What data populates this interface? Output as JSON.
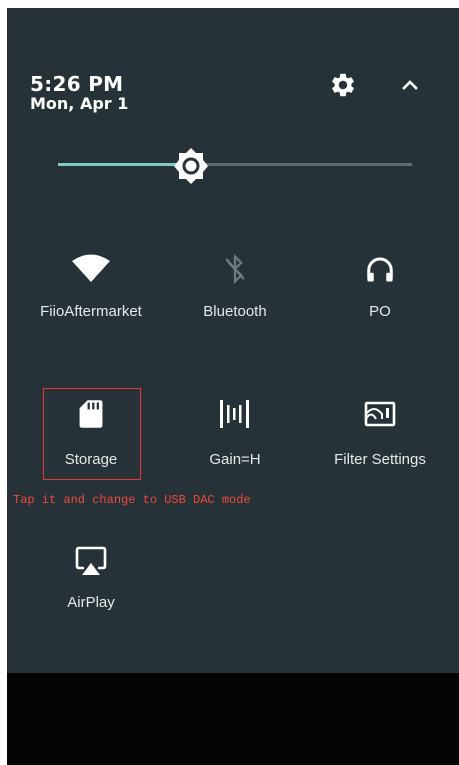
{
  "status": {
    "time": "5:26 PM",
    "date": "Mon, Apr 1"
  },
  "header_icons": {
    "settings": "gear-icon",
    "collapse": "chevron-up-icon"
  },
  "brightness": {
    "level_percent": 37
  },
  "tiles": {
    "wifi": {
      "label": "FiioAftermarket",
      "icon": "wifi-icon"
    },
    "bluetooth": {
      "label": "Bluetooth",
      "icon": "bluetooth-disabled-icon"
    },
    "po": {
      "label": "PO",
      "icon": "headphones-icon"
    },
    "storage": {
      "label": "Storage",
      "icon": "sd-card-icon"
    },
    "gain": {
      "label": "Gain=H",
      "icon": "gain-icon"
    },
    "filter": {
      "label": "Filter Settings",
      "icon": "filter-icon"
    },
    "airplay": {
      "label": "AirPlay",
      "icon": "airplay-icon"
    }
  },
  "annotation": {
    "text": "Tap it and change to USB DAC mode",
    "color": "#f04a3c"
  },
  "colors": {
    "panel_bg": "#263238",
    "accent": "#80cbc4"
  }
}
